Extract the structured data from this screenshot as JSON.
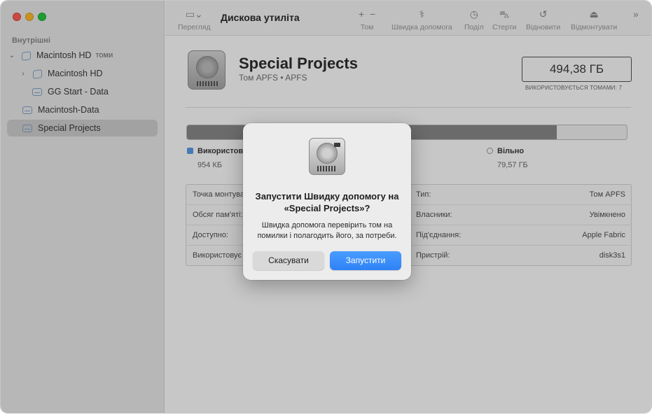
{
  "app": {
    "title": "Дискова утиліта"
  },
  "sidebar": {
    "section_label": "Внутрішні",
    "items": [
      {
        "label": "Macintosh HD",
        "sublabel": "томи"
      },
      {
        "label": "Macintosh HD"
      },
      {
        "label": "GG Start - Data"
      },
      {
        "label": "Macintosh-Data"
      },
      {
        "label": "Special Projects"
      }
    ]
  },
  "toolbar": {
    "view_label": "Перегляд",
    "volume_label": "Том",
    "first_aid_label": "Швидка допомога",
    "partition_label": "Поділ",
    "erase_label": "Стерти",
    "restore_label": "Відновити",
    "unmount_label": "Відмонтувати"
  },
  "volume": {
    "name": "Special Projects",
    "subtitle": "Том APFS • APFS",
    "capacity": "494,38 ГБ",
    "capacity_note": "ВИКОРИСТОВУЄТЬСЯ ТОМАМИ: 7",
    "usage_fraction": 0.84,
    "legend": {
      "used_label": "Використову",
      "used_value": "954 КБ",
      "free_label": "Вільно",
      "free_value": "79,57 ГБ"
    },
    "info_left": [
      {
        "key": "Точка монтува"
      },
      {
        "key": "Обсяг пам'яті:"
      },
      {
        "key": "Доступно:"
      },
      {
        "key": "Використовує"
      }
    ],
    "info_right": [
      {
        "key": "Тип:",
        "value": "Том APFS"
      },
      {
        "key": "Власники:",
        "value": "Увімкнено"
      },
      {
        "key": "Під'єднання:",
        "value": "Apple Fabric"
      },
      {
        "key": "Пристрій:",
        "value": "disk3s1"
      }
    ]
  },
  "dialog": {
    "title": "Запустити Швидку допомогу на «Special Projects»?",
    "message": "Швидка допомога перевірить том на помилки і полагодить його, за потреби.",
    "cancel_label": "Скасувати",
    "run_label": "Запустити"
  },
  "colors": {
    "accent": "#2f82f5",
    "used": "#5a9de8"
  }
}
